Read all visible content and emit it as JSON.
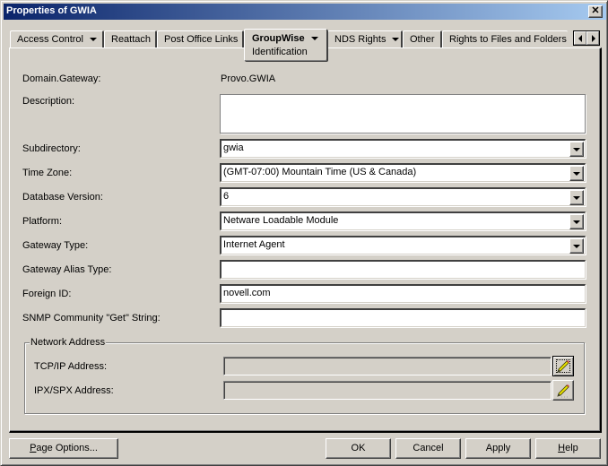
{
  "window": {
    "title": "Properties of GWIA",
    "close_icon": "close-icon"
  },
  "tabs": [
    {
      "label": "Access Control",
      "has_dropdown": true,
      "active": false
    },
    {
      "label": "Reattach",
      "has_dropdown": false,
      "active": false
    },
    {
      "label": "Post Office Links",
      "has_dropdown": false,
      "active": false
    },
    {
      "label": "GroupWise",
      "sublabel": "Identification",
      "has_dropdown": true,
      "active": true
    },
    {
      "label": "NDS Rights",
      "has_dropdown": true,
      "active": false
    },
    {
      "label": "Other",
      "has_dropdown": false,
      "active": false
    },
    {
      "label": "Rights to Files and Folders",
      "has_dropdown": false,
      "active": false
    }
  ],
  "tab_scroll": {
    "left_icon": "arrow-left-icon",
    "right_icon": "arrow-right-icon"
  },
  "form": {
    "domain_gateway": {
      "label": "Domain.Gateway:",
      "value": "Provo.GWIA"
    },
    "description": {
      "label": "Description:",
      "value": ""
    },
    "subdirectory": {
      "label": "Subdirectory:",
      "value": "gwia"
    },
    "time_zone": {
      "label": "Time Zone:",
      "value": "(GMT-07:00) Mountain Time (US & Canada)"
    },
    "database_version": {
      "label": "Database Version:",
      "value": "6"
    },
    "platform": {
      "label": "Platform:",
      "value": "Netware Loadable Module"
    },
    "gateway_type": {
      "label": "Gateway Type:",
      "value": "Internet Agent"
    },
    "gateway_alias_type": {
      "label": "Gateway Alias Type:",
      "value": ""
    },
    "foreign_id": {
      "label": "Foreign ID:",
      "value": "novell.com"
    },
    "snmp_get": {
      "label": "SNMP Community \"Get\" String:",
      "value": ""
    }
  },
  "network_address": {
    "title": "Network Address",
    "tcpip": {
      "label": "TCP/IP Address:",
      "value": ""
    },
    "ipxspx": {
      "label": "IPX/SPX Address:",
      "value": ""
    },
    "edit_icon": "pencil-icon"
  },
  "buttons": {
    "page_options": {
      "pre": "",
      "accel": "P",
      "post": "age Options..."
    },
    "ok": "OK",
    "cancel": "Cancel",
    "apply": "Apply",
    "help": {
      "pre": "",
      "accel": "H",
      "post": "elp"
    }
  }
}
